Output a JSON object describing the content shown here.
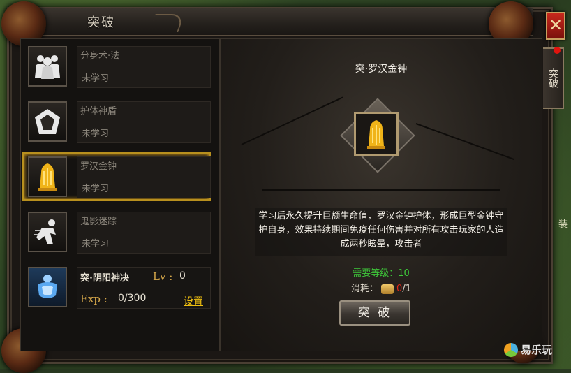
{
  "window": {
    "title": "突破",
    "close_glyph": "✕"
  },
  "side_tab": {
    "label": "突破"
  },
  "side_edge_text": "装",
  "skills": [
    {
      "name": "分身术·法",
      "state": "未学习",
      "icon": "clone-figures-icon"
    },
    {
      "name": "护体神盾",
      "state": "未学习",
      "icon": "shield-icon"
    },
    {
      "name": "罗汉金钟",
      "state": "未学习",
      "icon": "golden-bell-icon",
      "selected": true
    },
    {
      "name": "鬼影迷踪",
      "state": "未学习",
      "icon": "phantom-dash-icon"
    }
  ],
  "active_skill": {
    "name": "突·阴阳神决",
    "lv_label": "Lv :",
    "lv_value": "0",
    "exp_label": "Exp :",
    "exp_value": "0/300",
    "settings_label": "设置",
    "icon": "yinyang-armor-icon"
  },
  "detail": {
    "title": "突·罗汉金钟",
    "icon": "golden-bell-icon",
    "description": "学习后永久提升巨额生命值，罗汉金钟护体，形成巨型金钟守护自身，效果持续期间免疫任何伤害并对所有攻击玩家的人造成两秒眩晕，攻击者",
    "req_label": "需要等级：",
    "req_value": "10",
    "cost_label": "消耗：",
    "cost_have": "0",
    "cost_need": "/1",
    "button_label": "突 破"
  },
  "watermark": "易乐玩",
  "colors": {
    "gold": "#d4a64a",
    "green": "#3ec83a",
    "red": "#e0281a",
    "select_border": "#b8901e"
  }
}
